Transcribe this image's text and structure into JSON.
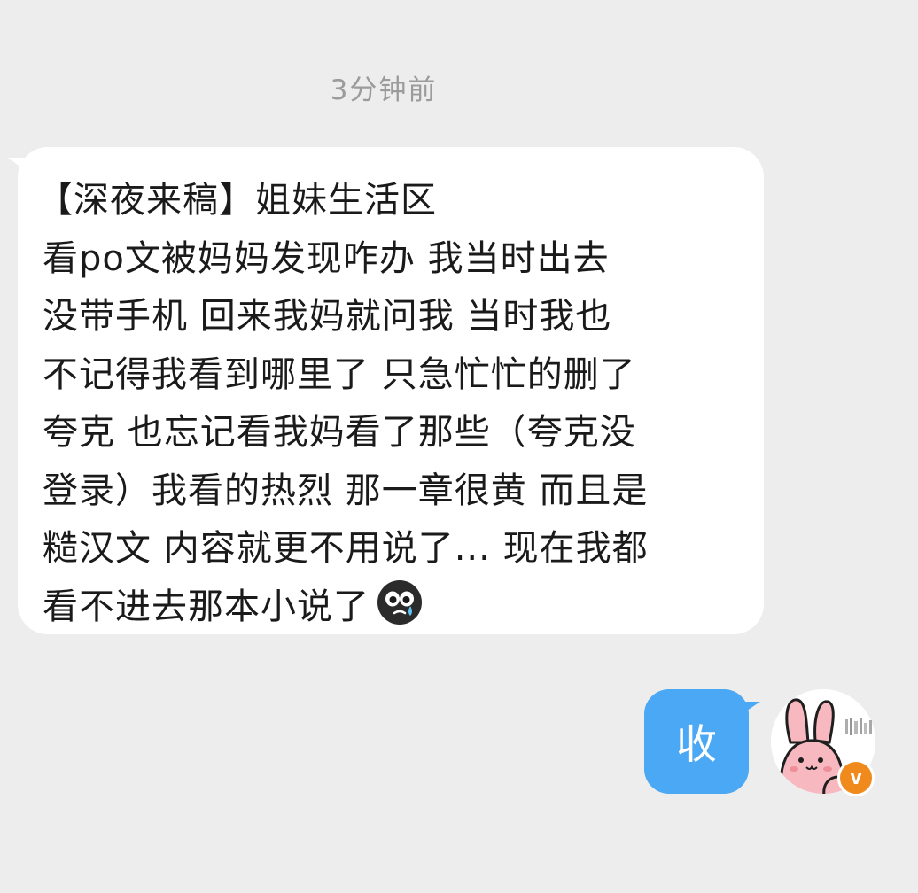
{
  "timestamp": "3分钟前",
  "incoming_message": {
    "lines": [
      "【深夜来稿】姐妹生活区",
      "看po文被妈妈发现咋办 我当时出去",
      "没带手机 回来我妈就问我 当时我也",
      "不记得我看到哪里了 只急忙忙的删了",
      "夸克 也忘记看我妈看了那些（夸克没",
      "登录）我看的热烈 那一章很黄 而且是",
      "糙汉文 内容就更不用说了... 现在我都",
      "看不进去那本小说了"
    ],
    "emoji": "crying-face-icon"
  },
  "outgoing_message": {
    "text": "收"
  },
  "colors": {
    "background": "#ededed",
    "incoming_bubble": "#ffffff",
    "outgoing_bubble": "#4aa8f5",
    "badge": "#f08a1d"
  }
}
